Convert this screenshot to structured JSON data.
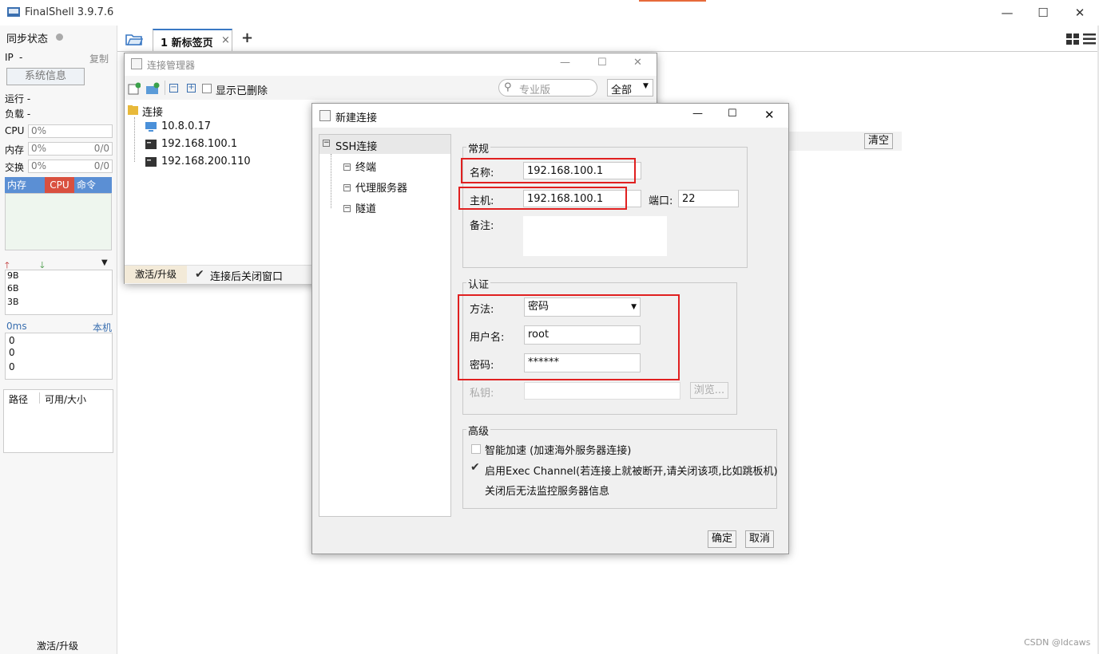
{
  "app": {
    "title": "FinalShell 3.9.7.6"
  },
  "left_panel": {
    "sync_status": "同步状态",
    "ip_label": "IP",
    "ip_value": "-",
    "copy_label": "复制",
    "sysinfo_button": "系统信息",
    "running_label": "运行 -",
    "load_label": "负载 -",
    "cpu_label": "CPU",
    "cpu_value": "0%",
    "mem_label": "内存",
    "mem_value": "0%",
    "mem_extra": "0/0",
    "swap_label": "交换",
    "swap_value": "0%",
    "swap_extra": "0/0",
    "tabs": [
      "内存",
      "CPU",
      "命令"
    ],
    "net_ticks": [
      "9B",
      "6B",
      "3B"
    ],
    "latency_label": "0ms",
    "local_label": "本机",
    "latency_ticks": [
      "0",
      "0",
      "0"
    ],
    "disk_col_path": "路径",
    "disk_col_size": "可用/大小",
    "activate_label": "激活/升级"
  },
  "tabbar": {
    "tab_label": "1 新标签页",
    "close": "×",
    "add": "+"
  },
  "bg_panel": {
    "clear_button": "清空"
  },
  "conn_manager": {
    "title": "连接管理器",
    "show_deleted": "显示已删除",
    "search_placeholder": "专业版",
    "filter_value": "全部",
    "root": "连接",
    "items": [
      "10.8.0.17",
      "192.168.100.1",
      "192.168.200.110"
    ],
    "activate": "激活/升级",
    "close_after_connect": "连接后关闭窗口"
  },
  "new_conn": {
    "title": "新建连接",
    "tree": {
      "root": "SSH连接",
      "children": [
        "终端",
        "代理服务器",
        "隧道"
      ]
    },
    "general": {
      "group_title": "常规",
      "name_label": "名称:",
      "name_value": "192.168.100.1",
      "host_label": "主机:",
      "host_value": "192.168.100.1",
      "port_label": "端口:",
      "port_value": "22",
      "note_label": "备注:"
    },
    "auth": {
      "group_title": "认证",
      "method_label": "方法:",
      "method_value": "密码",
      "user_label": "用户名:",
      "user_value": "root",
      "pass_label": "密码:",
      "pass_value": "******",
      "key_label": "私钥:",
      "browse_button": "浏览..."
    },
    "advanced": {
      "group_title": "高级",
      "smart_accel": "智能加速 (加速海外服务器连接)",
      "smart_accel_checked": false,
      "exec_channel": "启用Exec Channel(若连接上就被断开,请关闭该项,比如跳板机)",
      "exec_channel_checked": true,
      "exec_note": "关闭后无法监控服务器信息"
    },
    "ok_button": "确定",
    "cancel_button": "取消"
  },
  "watermark": "CSDN @ldcaws",
  "colors": {
    "mem_tab": "#5b8fd4",
    "cpu_tab": "#d9503f",
    "highlight": "#e02020"
  }
}
